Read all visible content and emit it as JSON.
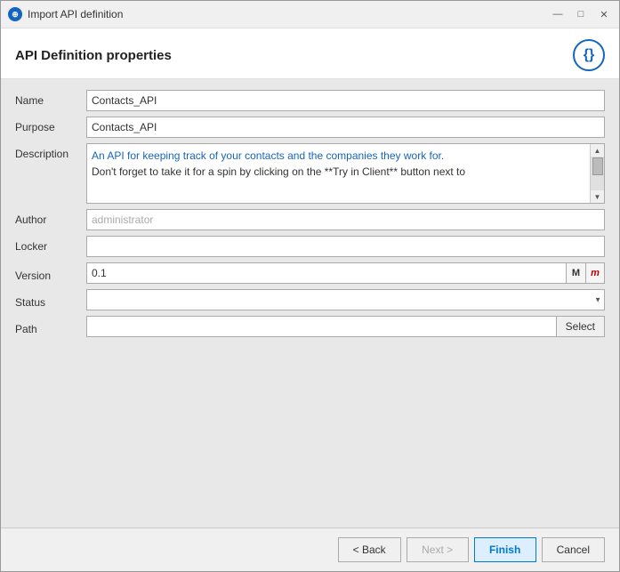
{
  "titlebar": {
    "icon": "⚙",
    "title": "Import API definition",
    "minimize": "—",
    "maximize": "□",
    "close": "✕"
  },
  "header": {
    "page_title": "API Definition properties",
    "api_icon": "{}"
  },
  "form": {
    "name_label": "Name",
    "name_value": "Contacts_API",
    "purpose_label": "Purpose",
    "purpose_value": "Contacts_API",
    "description_label": "Description",
    "description_line1": "An API for keeping track of your contacts and the companies they work for.",
    "description_line2": "Don't forget to take it for a spin by clicking on the **Try in Client** button next to",
    "author_label": "Author",
    "author_value": "administrator",
    "locker_label": "Locker",
    "locker_value": "",
    "version_label": "Version",
    "version_value": "0.1",
    "version_btn_M": "M",
    "version_btn_m": "m",
    "status_label": "Status",
    "status_value": "",
    "path_label": "Path",
    "path_value": "",
    "select_btn": "Select"
  },
  "footer": {
    "back_btn": "< Back",
    "next_btn": "Next >",
    "finish_btn": "Finish",
    "cancel_btn": "Cancel"
  }
}
